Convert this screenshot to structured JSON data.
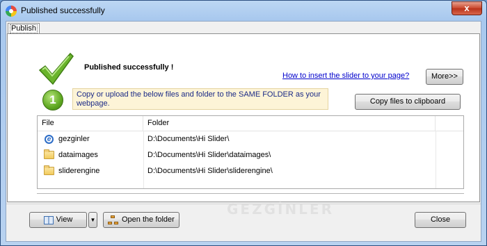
{
  "window": {
    "title": "Published successfully",
    "close_glyph": "x"
  },
  "tab": {
    "label": "Publish"
  },
  "status": {
    "heading": "Published successfully !",
    "howto_link": "How to insert the slider to your page?",
    "more_label": "More>>",
    "step_number": "1",
    "instruction": "Copy or upload the below files and folder to the SAME FOLDER as your webpage.",
    "copy_label": "Copy files to clipboard"
  },
  "file_list": {
    "columns": [
      "File",
      "Folder"
    ],
    "rows": [
      {
        "name": "gezginler",
        "folder": "D:\\Documents\\Hi Slider\\",
        "icon": "ie-icon"
      },
      {
        "name": "dataimages",
        "folder": "D:\\Documents\\Hi Slider\\dataimages\\",
        "icon": "folder-icon"
      },
      {
        "name": "sliderengine",
        "folder": "D:\\Documents\\Hi Slider\\sliderengine\\",
        "icon": "folder-icon"
      }
    ]
  },
  "footer": {
    "view_label": "View",
    "view_dropdown_glyph": "▼",
    "open_folder_label": "Open the folder",
    "close_label": "Close"
  },
  "watermark": "GEZGİNLER",
  "colors": {
    "link": "#0000cc",
    "note_bg": "#fdf4d7",
    "note_text": "#1a2a86",
    "check_green": "#5fa821",
    "title_close": "#c9462b"
  }
}
